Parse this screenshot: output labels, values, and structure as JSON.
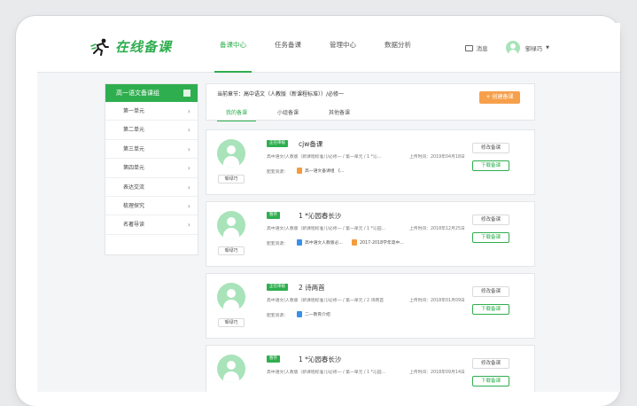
{
  "header": {
    "logo_text": "在线备课",
    "nav": [
      "备课中心",
      "任务备课",
      "管理中心",
      "数据分析"
    ],
    "message_label": "消息",
    "user_name": "邹绿巧"
  },
  "sidebar": {
    "title": "高一语文备课组",
    "items": [
      "第一单元",
      "第二单元",
      "第三单元",
      "第四单元",
      "表达交流",
      "梳理探究",
      "名著导读"
    ]
  },
  "topbox": {
    "breadcrumb": "当前章节：高中语文（人教版（新课程标准））/必修一",
    "create_button": "+ 创建备课",
    "tabs": [
      "我的备课",
      "小组备课",
      "其他备课"
    ]
  },
  "cards": [
    {
      "status": "正在审核",
      "title": "cjw备课",
      "meta": "高中语文(人教版（新课程标准）)/必修一 / 第一单元 / 1 *沁...",
      "time": "上传时间：2019年04月18日",
      "author": "邹绿巧",
      "resources_label": "配套资源：",
      "resources": [
        {
          "icon": "ppt",
          "name": "高一语文备课组 《..."
        }
      ],
      "edit_label": "修改备课",
      "download_label": "下载备课"
    },
    {
      "status": "暂存",
      "title": "1 *沁园春长沙",
      "meta": "高中语文(人教版（新课程标准）)/必修一 / 第一单元 / 1 *沁园...",
      "time": "上传时间：2018年12月25日",
      "author": "邹绿巧",
      "resources_label": "配套资源：",
      "resources": [
        {
          "icon": "doc",
          "name": "高中语文人教版必..."
        },
        {
          "icon": "ppt",
          "name": "2017-2018学年高中..."
        }
      ],
      "edit_label": "修改备课",
      "download_label": "下载备课"
    },
    {
      "status": "正在审核",
      "title": "2 诗两首",
      "meta": "高中语文(人教版（新课程标准）)/必修一 / 第一单元 / 2 诗两首",
      "time": "上传时间：2018年01月09日",
      "author": "邹绿巧",
      "resources_label": "配套资源：",
      "resources": [
        {
          "icon": "doc",
          "name": "二一教育介绍"
        }
      ],
      "edit_label": "修改备课",
      "download_label": "下载备课"
    },
    {
      "status": "暂存",
      "title": "1 *沁园春长沙",
      "meta": "高中语文(人教版（新课程标准）)/必修一 / 第一单元 / 1 *沁园...",
      "time": "上传时间：2018年09月14日",
      "author": "邹绿巧",
      "resources_label": "",
      "resources": [],
      "edit_label": "修改备课",
      "download_label": "下载备课"
    }
  ],
  "colors": {
    "accent": "#2fae4f",
    "orange": "#f6a04b"
  }
}
